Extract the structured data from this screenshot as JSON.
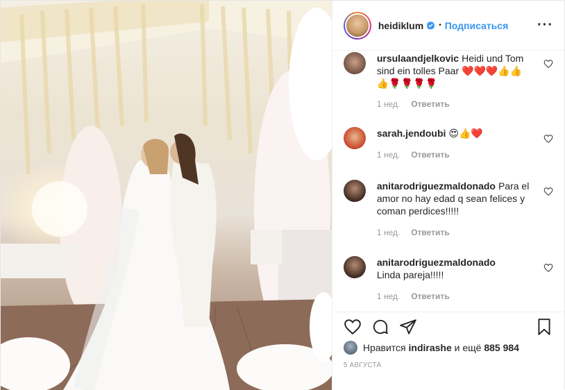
{
  "post": {
    "image_alt": "Wedding photo",
    "author": "heidiklum",
    "verified": true,
    "follow_label": "Подписаться",
    "more_icon": "more-horizontal-icon"
  },
  "comments": [
    {
      "user": "ursulaandjelkovic",
      "text": "Heidi und Tom sind ein tolles Paar ❤️❤️❤️👍👍👍🌹🌹🌹🌹",
      "time": "1 нед.",
      "reply": "Ответить",
      "avatar_color": "#6b4a3f"
    },
    {
      "user": "sarah.jendoubi",
      "text": "😍👍❤️",
      "time": "1 нед.",
      "reply": "Ответить",
      "avatar_color": "#c9452a"
    },
    {
      "user": "anitarodriguezmaldonado",
      "text": "Para el amor no hay edad q sean felices y coman perdices!!!!!",
      "time": "1 нед.",
      "reply": "Ответить",
      "avatar_color": "#3e2a22"
    },
    {
      "user": "anitarodriguezmaldonado",
      "text": "Linda pareja!!!!!",
      "time": "1 нед.",
      "reply": "Ответить",
      "avatar_color": "#3e2a22"
    }
  ],
  "likes": {
    "prefix": "Нравится",
    "user": "indirashe",
    "middle": "и ещё",
    "count": "885 984"
  },
  "date": "5 АВГУСТА"
}
